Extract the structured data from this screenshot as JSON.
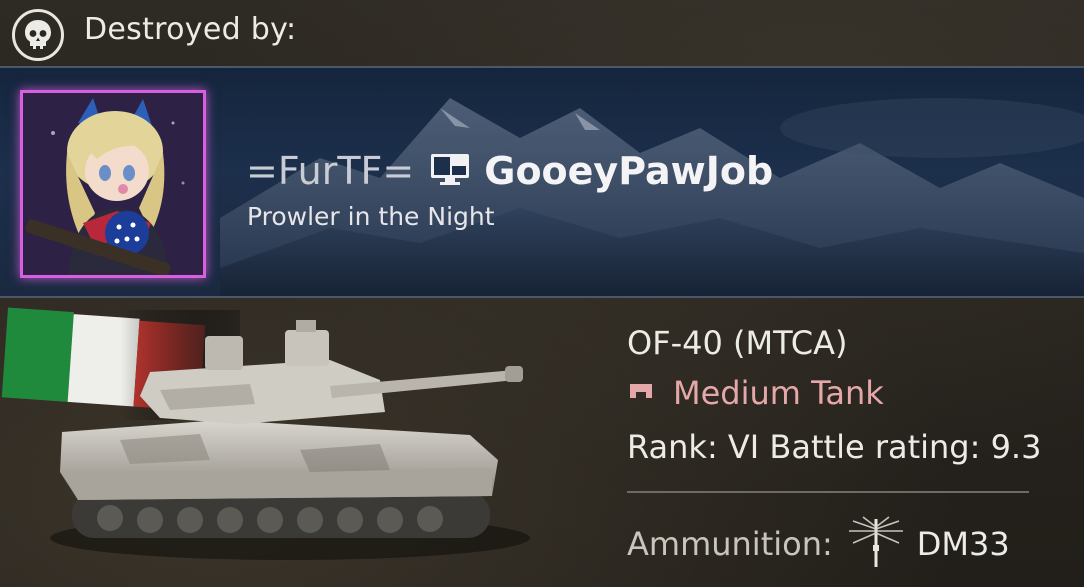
{
  "header": {
    "icon": "skull-icon",
    "label": "Destroyed by:"
  },
  "player": {
    "clan_tag": "=FurTF=",
    "platform_icon": "pc-monitor-icon",
    "name": "GooeyPawJob",
    "title": "Prowler in the Night",
    "avatar_frame_color": "#d85fe0"
  },
  "vehicle": {
    "name": "OF-40 (MTCA)",
    "class_icon": "medium-tank-class-icon",
    "class": "Medium Tank",
    "class_color": "#e5a8a8",
    "rank_line": "Rank: VI Battle rating: 9.3",
    "flag": "italy-flag",
    "ammo_label": "Ammunition:",
    "ammo_icon": "apfsds-shell-icon",
    "ammo_name": "DM33"
  }
}
